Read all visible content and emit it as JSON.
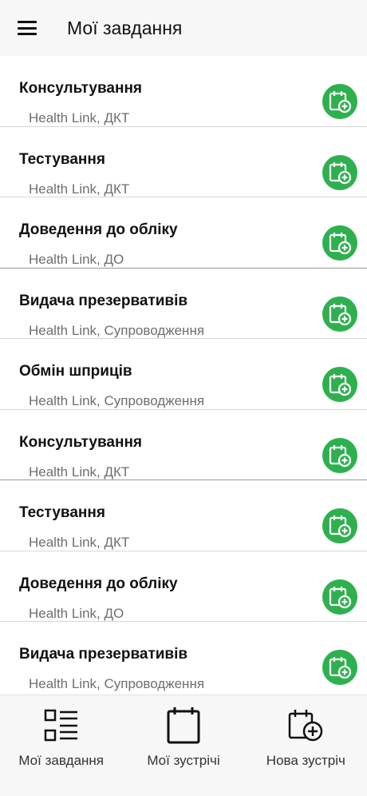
{
  "header": {
    "title": "Мої завдання"
  },
  "tasks": [
    {
      "title": "Консультування",
      "subtitle": "Health Link, ДКТ"
    },
    {
      "title": "Тестування",
      "subtitle": "Health Link, ДКТ"
    },
    {
      "title": "Доведення до обліку",
      "subtitle": "Health Link, ДО"
    },
    {
      "title": "Видача презервативів",
      "subtitle": "Health Link, Супроводження"
    },
    {
      "title": "Обмін шприців",
      "subtitle": "Health Link, Супроводження"
    },
    {
      "title": "Консультування",
      "subtitle": "Health Link, ДКТ"
    },
    {
      "title": "Тестування",
      "subtitle": "Health Link, ДКТ"
    },
    {
      "title": "Доведення до обліку",
      "subtitle": "Health Link, ДО"
    },
    {
      "title": "Видача презервативів",
      "subtitle": "Health Link, Супроводження"
    }
  ],
  "bottom_nav": {
    "items": [
      {
        "label": "Мої завдання",
        "icon": "task-list-icon"
      },
      {
        "label": "Мої зустрічі",
        "icon": "calendar-icon"
      },
      {
        "label": "Нова зустріч",
        "icon": "calendar-add-icon"
      }
    ]
  },
  "colors": {
    "accent_green": "#2fb04f",
    "bar_background": "#f7f7f7",
    "subtitle_gray": "#6e6e6e"
  }
}
